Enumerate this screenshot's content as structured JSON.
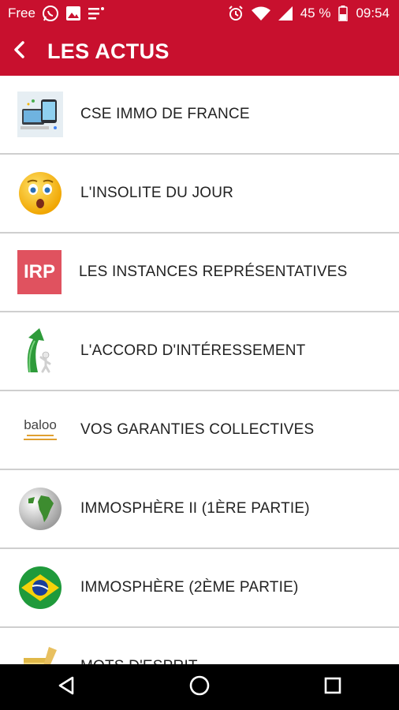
{
  "status_bar": {
    "carrier": "Free",
    "battery": "45 %",
    "time": "09:54",
    "icons": [
      "whatsapp-icon",
      "image-icon",
      "notes-icon",
      "alarm-icon",
      "wifi-icon",
      "signal-icon",
      "battery-icon"
    ]
  },
  "header": {
    "title": "LES ACTUS",
    "back_icon": "chevron-left-icon",
    "color": "#c8102e"
  },
  "list": {
    "items": [
      {
        "label": "CSE IMMO DE FRANCE",
        "icon": "devices-thumbnail"
      },
      {
        "label": "L'INSOLITE DU JOUR",
        "icon": "surprised-emoji-icon"
      },
      {
        "label": "LES INSTANCES REPRÉSENTATIVES",
        "icon": "irp-logo",
        "logo_text": "IRP"
      },
      {
        "label": "L'ACCORD D'INTÉRESSEMENT",
        "icon": "green-arrow-figure-icon"
      },
      {
        "label": "VOS GARANTIES COLLECTIVES",
        "icon": "baloo-logo",
        "logo_text": "baloo"
      },
      {
        "label": "IMMOSPHÈRE II (1ÈRE PARTIE)",
        "icon": "globe-icon"
      },
      {
        "label": "IMMOSPHÈRE (2ÈME PARTIE)",
        "icon": "brazil-flag-icon"
      },
      {
        "label": "MOTS D'ESPRIT",
        "icon": "notepad-pencil-icon"
      }
    ]
  },
  "nav_bar": {
    "buttons": [
      "back-triangle-icon",
      "home-circle-icon",
      "recents-square-icon"
    ]
  }
}
